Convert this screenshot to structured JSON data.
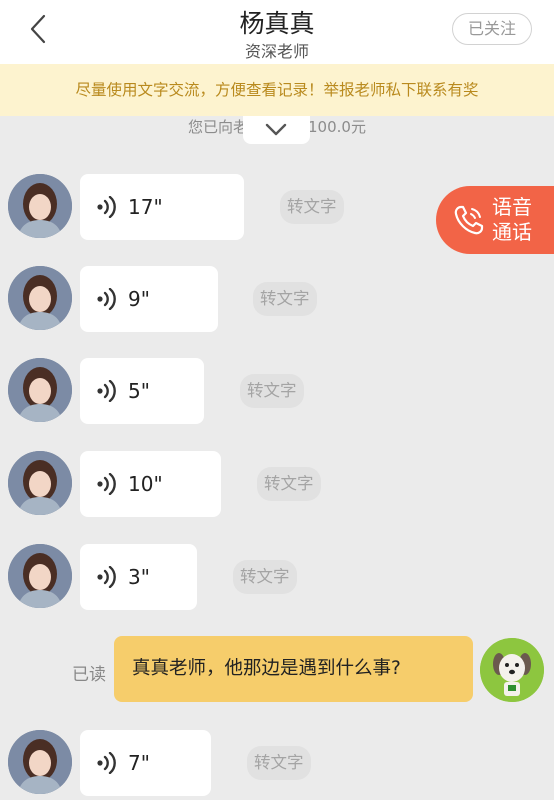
{
  "header": {
    "title": "杨真真",
    "subtitle": "资深老师",
    "follow_label": "已关注"
  },
  "notice": "尽量使用文字交流，方便查看记录！举报老师私下联系有奖",
  "tip": "您已向老师支付了100.0元",
  "call_button": {
    "line1": "语音",
    "line2": "通话"
  },
  "convert_label": "转文字",
  "voice_messages": [
    {
      "duration": "17\""
    },
    {
      "duration": "9\""
    },
    {
      "duration": "5\""
    },
    {
      "duration": "10\""
    },
    {
      "duration": "3\""
    },
    {
      "duration": "7\""
    }
  ],
  "my_message": {
    "read_status": "已读",
    "text": "真真老师，他那边是遇到什么事?"
  },
  "colors": {
    "notice_bg": "#fdf3cf",
    "notice_text": "#b98a1e",
    "call_button": "#f26447",
    "my_bubble": "#f6cd6b",
    "background": "#ebebeb"
  }
}
